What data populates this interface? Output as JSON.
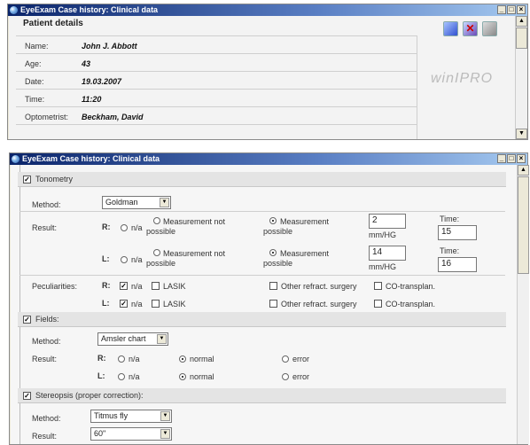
{
  "window1": {
    "title": "EyeExam Case history: Clinical data",
    "section_title": "Patient details",
    "fields": [
      {
        "label": "Name:",
        "value": "John J. Abbott"
      },
      {
        "label": "Age:",
        "value": "43"
      },
      {
        "label": "Date:",
        "value": "19.03.2007"
      },
      {
        "label": "Time:",
        "value": "11:20"
      },
      {
        "label": "Optometrist:",
        "value": "Beckham, David"
      }
    ],
    "logo": "winIPRO"
  },
  "window2": {
    "title": "EyeExam Case history: Clinical data",
    "tonometry": {
      "header": "Tonometry",
      "method_label": "Method:",
      "method_value": "Goldman",
      "result_label": "Result:",
      "rows": [
        {
          "eye": "R:",
          "na": "n/a",
          "not_possible": "Measurement not possible",
          "possible": "Measurement possible",
          "value": "2",
          "unit": "mm/HG",
          "time_label": "Time:",
          "time_value": "15"
        },
        {
          "eye": "L:",
          "na": "n/a",
          "not_possible": "Measurement not possible",
          "possible": "Measurement possible",
          "value": "14",
          "unit": "mm/HG",
          "time_label": "Time:",
          "time_value": "16"
        }
      ],
      "peculiarities_label": "Peculiarities:",
      "pec_rows": [
        {
          "eye": "R:",
          "na": "n/a",
          "lasik": "LASIK",
          "other": "Other refract. surgery",
          "co": "CO-transplan."
        },
        {
          "eye": "L:",
          "na": "n/a",
          "lasik": "LASIK",
          "other": "Other refract. surgery",
          "co": "CO-transplan."
        }
      ]
    },
    "fields": {
      "header": "Fields:",
      "method_label": "Method:",
      "method_value": "Amsler chart",
      "result_label": "Result:",
      "rows": [
        {
          "eye": "R:",
          "na": "n/a",
          "normal": "normal",
          "error": "error"
        },
        {
          "eye": "L:",
          "na": "n/a",
          "normal": "normal",
          "error": "error"
        }
      ]
    },
    "stereopsis": {
      "header": "Stereopsis (proper correction):",
      "method_label": "Method:",
      "method_value": "Titmus fly",
      "result_label": "Result:",
      "result_value": "60\""
    }
  }
}
